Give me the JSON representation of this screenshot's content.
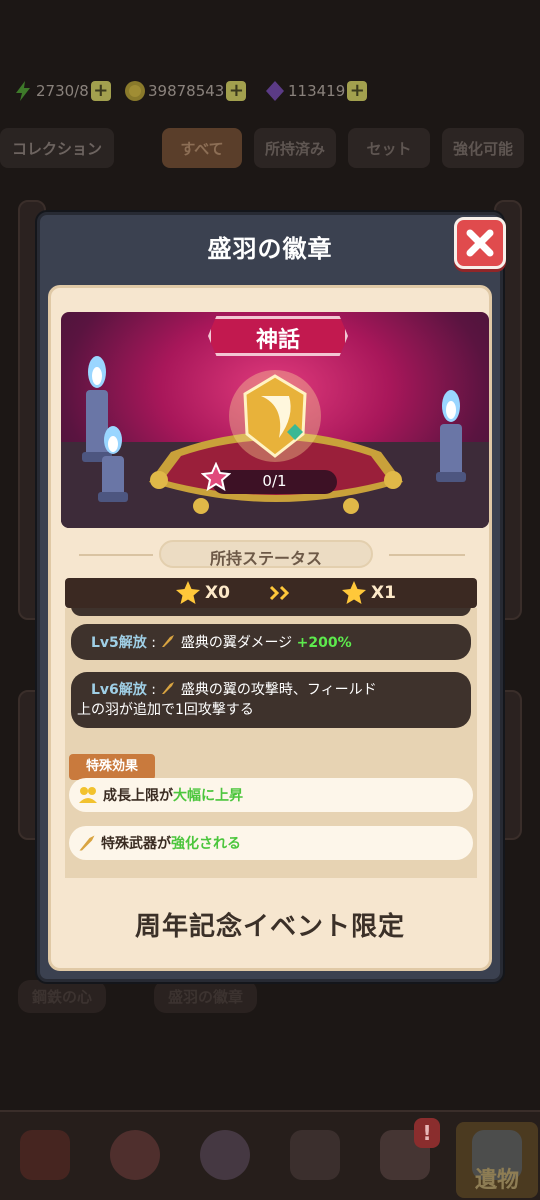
{
  "resources": {
    "energy": {
      "icon": "energy-bolt-icon",
      "value": "2730/8"
    },
    "coins": {
      "icon": "coin-icon",
      "value": "39878543"
    },
    "gems": {
      "icon": "purple-gem-icon",
      "value": "113419"
    }
  },
  "filter_tabs": {
    "collection": "コレクション",
    "all": "すべて",
    "owned": "所持済み",
    "set": "セット",
    "upgradable": "強化可能"
  },
  "background_labels": [
    "鋼鉄の心",
    "盛羽の徽章"
  ],
  "modal": {
    "title": "盛羽の徽章",
    "rarity": "神話",
    "owned_count": "0/1",
    "status_header": "所持ステータス",
    "star_from": "X0",
    "star_to": "X1",
    "stats": [
      {
        "level": "Lv5解放",
        "text": "盛典の翼ダメージ",
        "bonus": "+200%"
      },
      {
        "level": "Lv6解放",
        "text": "盛典の翼の攻撃時、フィールド",
        "text2": "上の羽が追加で1回攻撃する"
      }
    ],
    "special_effect_label": "特殊効果",
    "effects": [
      {
        "icon": "growth-cap-icon",
        "prefix": "成長上限が",
        "highlight": "大幅に上昇"
      },
      {
        "icon": "weapon-wing-icon",
        "prefix": "特殊武器が",
        "highlight": "強化される"
      }
    ],
    "limited_note": "周年記念イベント限定"
  },
  "bottom_nav": {
    "items": [
      "shop-icon",
      "nurse-icon",
      "egg-icon",
      "syringe-icon",
      "first-aid-icon",
      "relic-icon"
    ],
    "active_label": "遺物",
    "badge": "!"
  },
  "colors": {
    "mythic": "#c2194f",
    "close": "#e04b4d",
    "highlight_green": "#5dea4d"
  }
}
